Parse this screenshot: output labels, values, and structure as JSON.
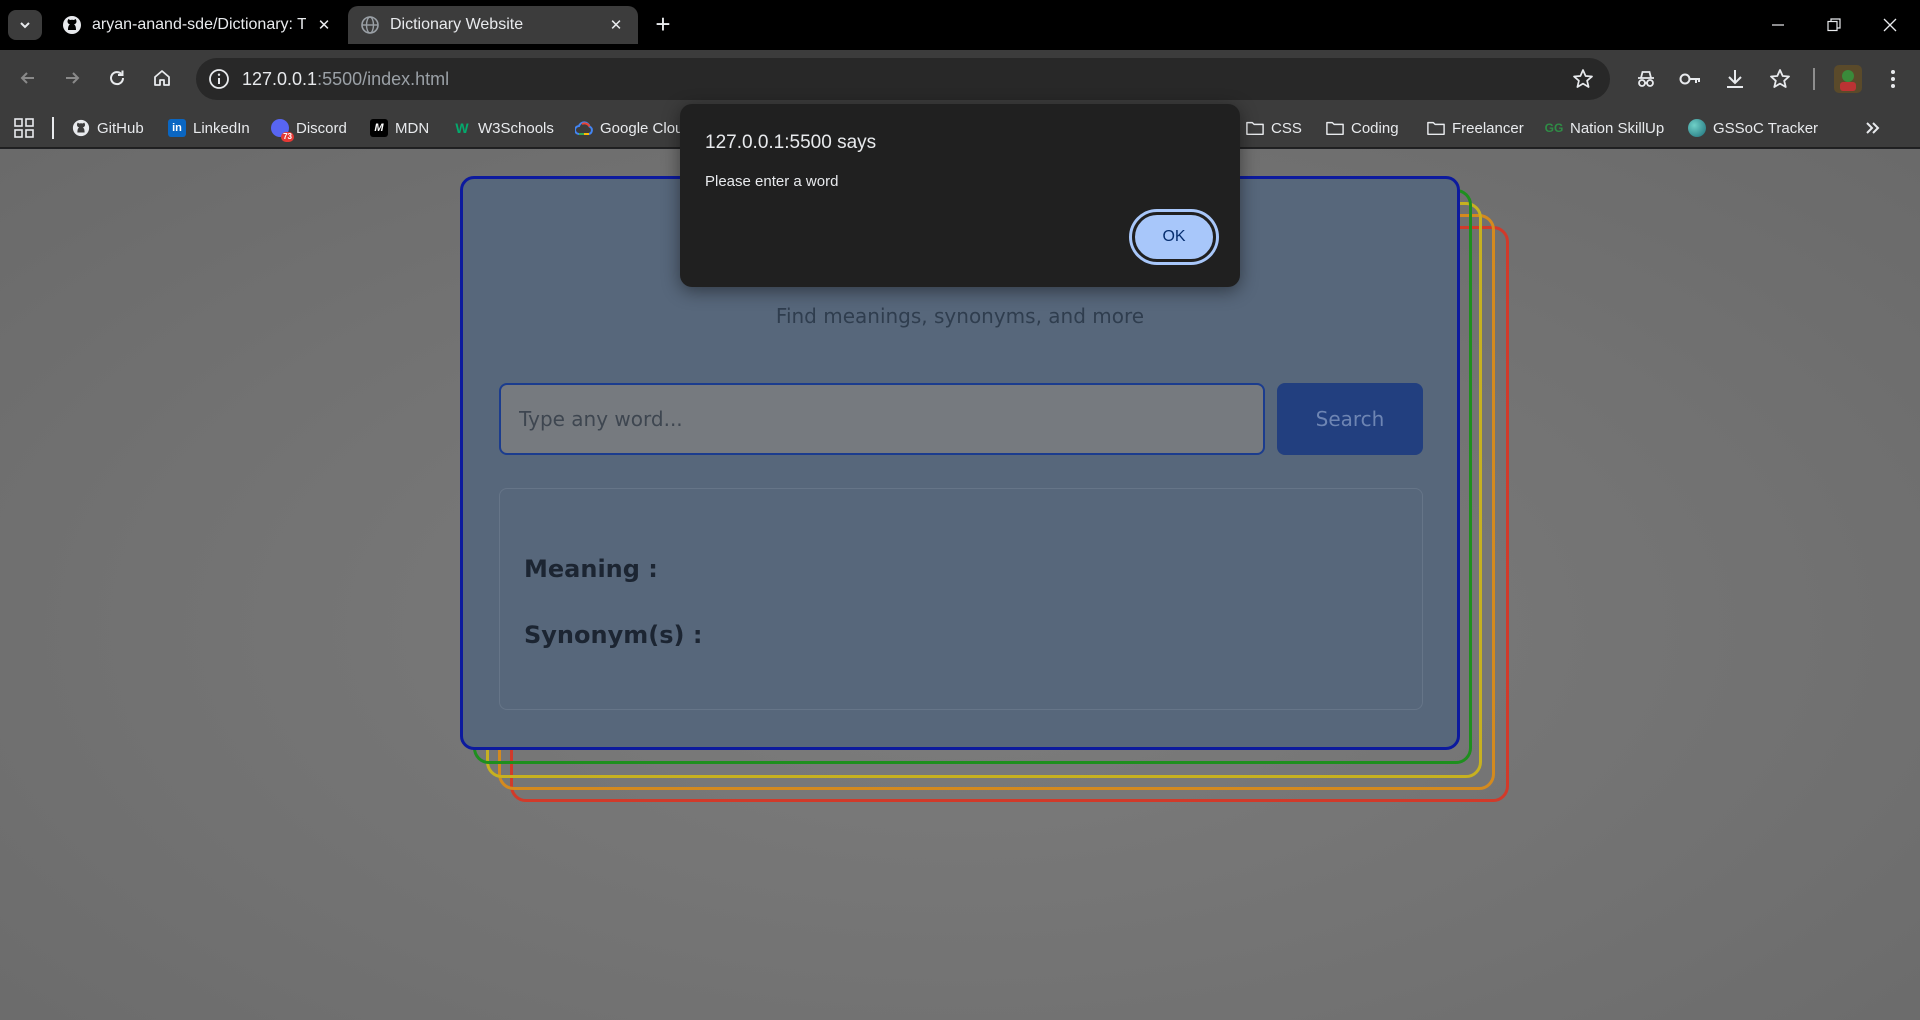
{
  "browser": {
    "tabs": [
      {
        "title": "aryan-anand-sde/Dictionary: Th",
        "favicon": "github-icon",
        "active": false
      },
      {
        "title": "Dictionary Website",
        "favicon": "globe-icon",
        "active": true
      }
    ],
    "address": {
      "host": "127.0.0.1",
      "rest": ":5500/index.html"
    },
    "bookmarks": [
      {
        "label": "GitHub",
        "icon": "github-icon"
      },
      {
        "label": "LinkedIn",
        "icon": "linkedin-icon"
      },
      {
        "label": "Discord",
        "icon": "discord-icon",
        "badge": "73"
      },
      {
        "label": "MDN",
        "icon": "mdn-icon"
      },
      {
        "label": "W3Schools",
        "icon": "w3schools-icon"
      },
      {
        "label": "Google Clou",
        "icon": "google-cloud-icon"
      },
      {
        "label": "CSS",
        "icon": "folder-icon"
      },
      {
        "label": "Coding",
        "icon": "folder-icon"
      },
      {
        "label": "Freelancer",
        "icon": "folder-icon"
      },
      {
        "label": "Nation SkillUp",
        "icon": "gfg-icon"
      },
      {
        "label": "GSSoC Tracker",
        "icon": "globe-icon"
      }
    ]
  },
  "page": {
    "subtitle": "Find meanings, synonyms, and more",
    "search": {
      "placeholder": "Type any word...",
      "value": "",
      "button_label": "Search"
    },
    "result": {
      "meaning_label": "Meaning :",
      "synonym_label": "Synonym(s) :"
    },
    "stack_colors": [
      "#0c1a9e",
      "#1e8f1e",
      "#c7b120",
      "#d48a1e",
      "#d13a2a"
    ]
  },
  "alert": {
    "title": "127.0.0.1:5500 says",
    "message": "Please enter a word",
    "ok_label": "OK"
  }
}
